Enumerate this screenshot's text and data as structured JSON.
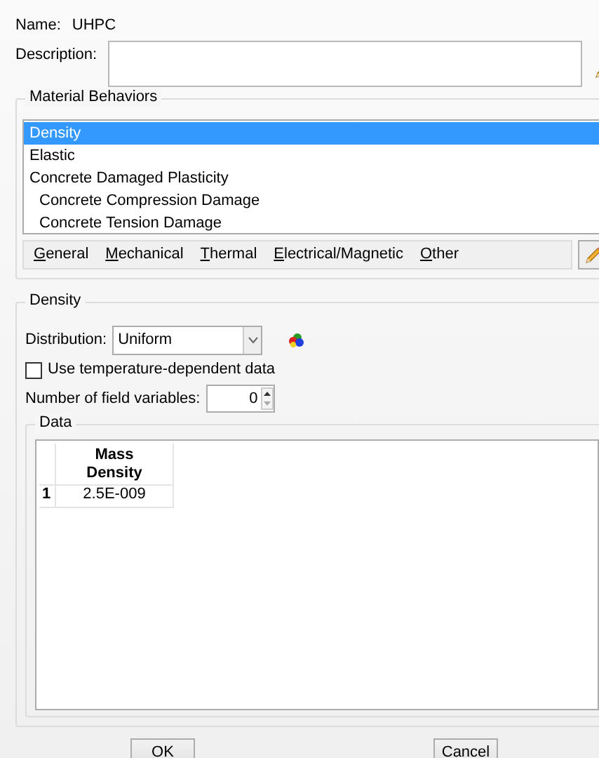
{
  "name": {
    "label": "Name:",
    "value": "UHPC"
  },
  "description": {
    "label": "Description:"
  },
  "material_behaviors": {
    "title": "Material Behaviors",
    "items": [
      {
        "label": "Density",
        "selected": true
      },
      {
        "label": "Elastic",
        "selected": false
      },
      {
        "label": "Concrete Damaged Plasticity",
        "selected": false,
        "children": [
          {
            "label": "Concrete Compression Damage",
            "selected": false
          },
          {
            "label": "Concrete Tension Damage",
            "selected": false
          }
        ]
      }
    ],
    "menus": [
      "General",
      "Mechanical",
      "Thermal",
      "Electrical/Magnetic",
      "Other"
    ]
  },
  "density": {
    "title": "Density",
    "distribution": {
      "label": "Distribution:",
      "value": "Uniform"
    },
    "temperature_dependent": {
      "label": "Use temperature-dependent data",
      "checked": false
    },
    "field_variables": {
      "label": "Number of field variables:",
      "value": "0"
    },
    "data": {
      "title": "Data",
      "columns": [
        "Mass\nDensity"
      ],
      "rows": [
        {
          "index": "1",
          "cells": [
            "2.5E-009"
          ]
        }
      ]
    }
  },
  "buttons": [
    "OK",
    "Cancel"
  ]
}
